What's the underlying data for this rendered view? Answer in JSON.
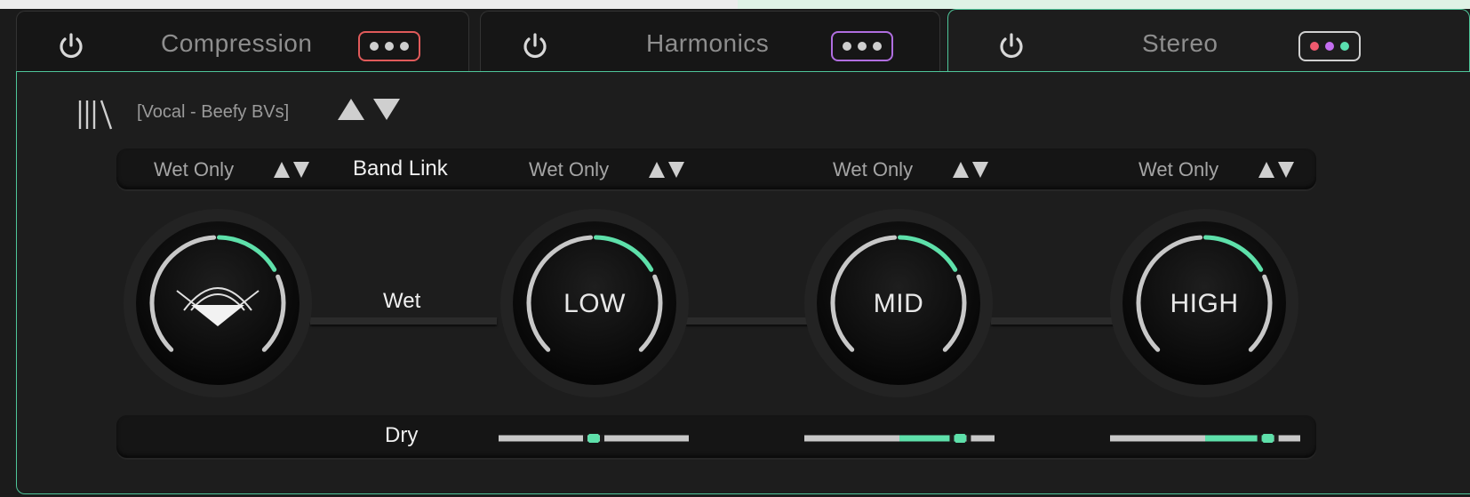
{
  "tabs": [
    {
      "label": "Compression",
      "menu_color": "#e05a5a",
      "dots": [
        "#cfcfcf",
        "#cfcfcf",
        "#cfcfcf"
      ]
    },
    {
      "label": "Harmonics",
      "menu_color": "#b06ee0",
      "dots": [
        "#cfcfcf",
        "#cfcfcf",
        "#cfcfcf"
      ]
    },
    {
      "label": "Stereo",
      "menu_color": "#d0d0d0",
      "dots": [
        "#f05a6e",
        "#c46ef0",
        "#5ae0b0"
      ]
    }
  ],
  "active_tab": "Stereo",
  "preset": {
    "name": "[Vocal - Beefy BVs]"
  },
  "bands": {
    "link_label": "Band Link",
    "wet_label": "Wet",
    "dry_label": "Dry",
    "mode_labels": [
      "Wet Only",
      "Wet Only",
      "Wet Only",
      "Wet Only"
    ]
  },
  "knobs": [
    {
      "label": "",
      "value": 0.72
    },
    {
      "label": "LOW",
      "value": 0.72
    },
    {
      "label": "MID",
      "value": 0.72
    },
    {
      "label": "HIGH",
      "value": 0.72
    }
  ],
  "sliders": [
    {
      "value": 0.5
    },
    {
      "value": 0.82
    },
    {
      "value": 0.83
    }
  ],
  "colors": {
    "accent": "#5ee0aa",
    "panel_border": "#4fc69a",
    "track": "#c8c8c8"
  }
}
